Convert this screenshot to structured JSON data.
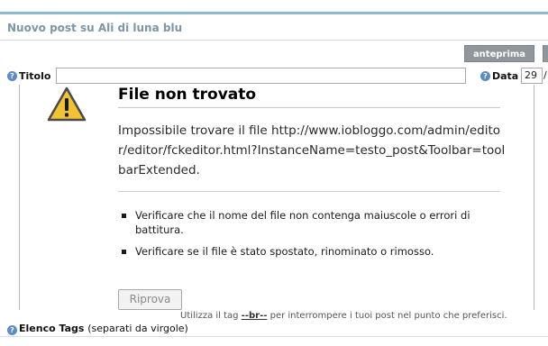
{
  "page": {
    "title": "Nuovo post su Ali di luna blu",
    "preview_button": "anteprima"
  },
  "form": {
    "title_label": "Titolo",
    "date_label": "Data",
    "date_day": "29",
    "date_separator": "/"
  },
  "error": {
    "title": "File non trovato",
    "message": "Impossibile trovare il file http://www.iobloggo.com/admin/editor/editor/fckeditor.html?InstanceName=testo_post&Toolbar=toolbarExtended.",
    "suggestions": [
      "Verificare che il nome del file non contenga maiuscole o errori di battitura.",
      "Verificare se il file è stato spostato, rinominato o rimosso."
    ],
    "retry_button": "Riprova"
  },
  "hint": {
    "prefix": "Utilizza il tag",
    "tag": "--br--",
    "suffix": "per interrompere i tuoi post nel punto che preferisci."
  },
  "tags": {
    "label": "Elenco Tags",
    "note": "(separati da virgole)"
  },
  "icons": {
    "help": "help-icon",
    "warning": "warning-triangle-icon"
  },
  "colors": {
    "title_text": "#7b96a8",
    "preview_button_bg": "#8f979d",
    "help_icon": "#5b8cc8",
    "warning_yellow": "#f1c232"
  }
}
